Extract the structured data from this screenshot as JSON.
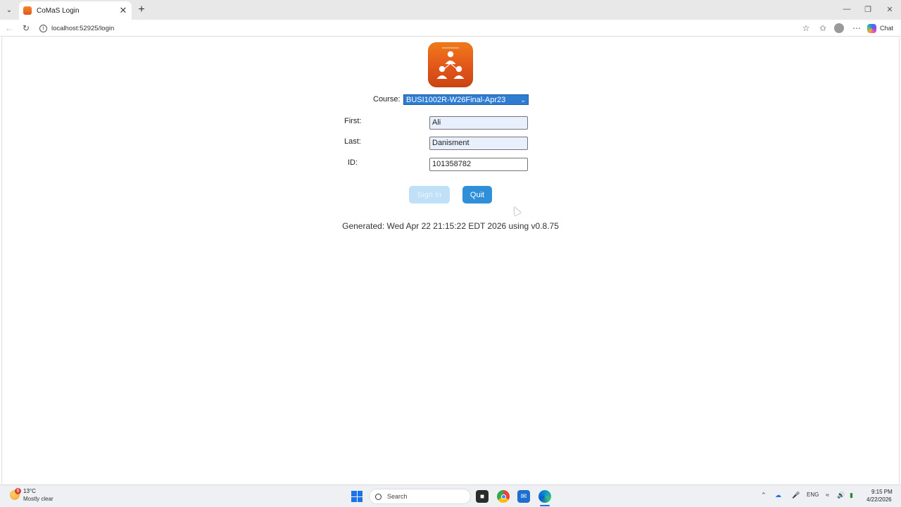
{
  "browser": {
    "tab_title": "CoMaS Login",
    "url": "localhost:52925/login",
    "chat_label": "Chat"
  },
  "form": {
    "course_label": "Course:",
    "course_value": "BUSI1002R-W26Final-Apr23",
    "first_label": "First:",
    "first_value": "Ali",
    "last_label": "Last:",
    "last_value": "Danisment",
    "id_label": "ID:",
    "id_value": "101358782",
    "signin_label": "Sign In",
    "quit_label": "Quit"
  },
  "footer": {
    "generated_text": "Generated: Wed Apr 22 21:15:22 EDT 2026 using v0.8.75"
  },
  "taskbar": {
    "weather_badge": "6",
    "weather_temp": "13°C",
    "weather_condition": "Mostly clear",
    "search_placeholder": "Search",
    "language": "ENG",
    "time": "9:15 PM",
    "date": "4/22/2026"
  },
  "colors": {
    "logo_orange": "#e2561a",
    "select_blue": "#2d7dd2",
    "quit_blue": "#2f8fd8",
    "signin_disabled": "#bfe0f7",
    "autofill_bg": "#e8f0fe"
  }
}
